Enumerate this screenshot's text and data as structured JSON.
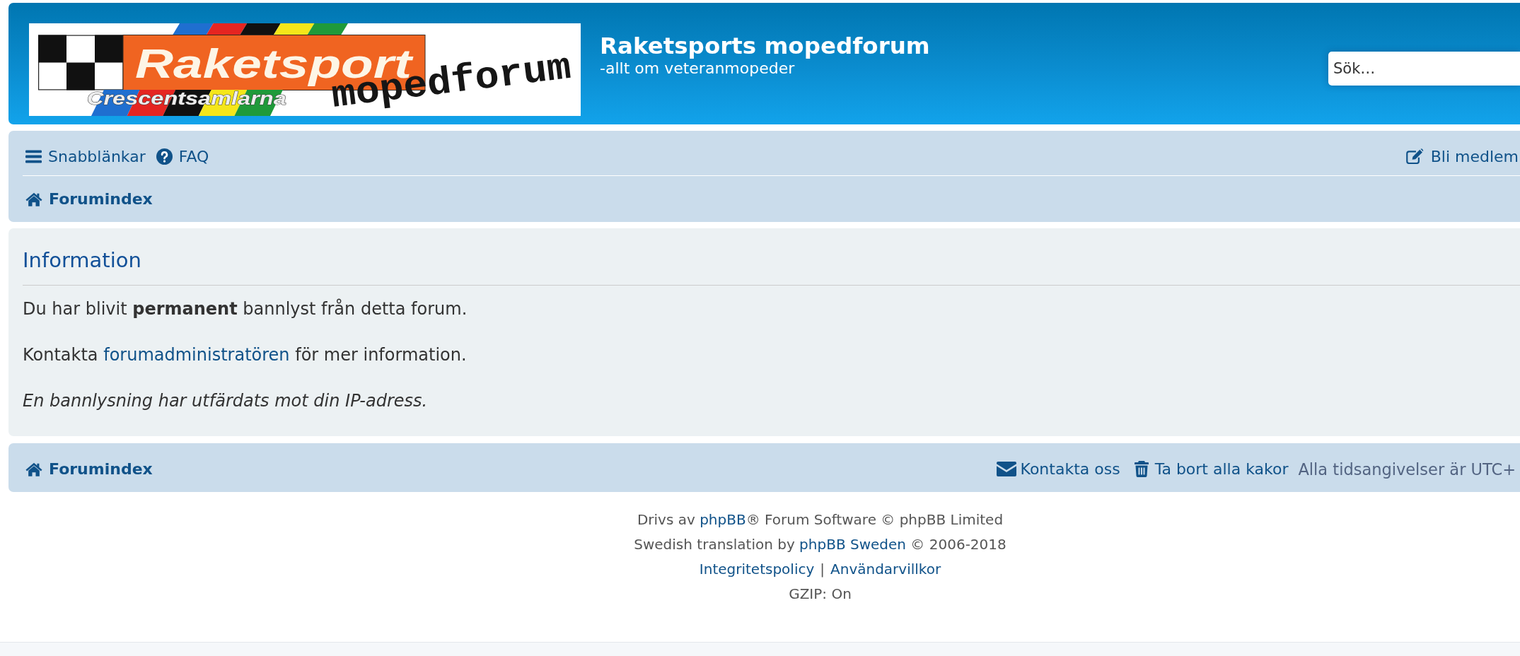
{
  "header": {
    "logo": {
      "wordmark": "Raketsport",
      "name": "mopedforum",
      "tagline": "Crescentsamlarna"
    },
    "title": "Raketsports mopedforum",
    "description": "-allt om veteranmopeder",
    "search": {
      "placeholder": "Sök…"
    }
  },
  "navbar": {
    "quick_links": "Snabblänkar",
    "faq": "FAQ",
    "register": "Bli medlem",
    "breadcrumb": "Forumindex"
  },
  "panel": {
    "title": "Information",
    "messages": [
      {
        "kind": "plain",
        "parts": [
          {
            "text": "Du har blivit **permanent** bannlyst från detta forum."
          }
        ]
      },
      {
        "kind": "plain",
        "parts": [
          {
            "text": "Kontakta "
          },
          {
            "link": "forumadministratören"
          },
          {
            "text": " för mer information."
          }
        ]
      },
      {
        "kind": "note",
        "parts": [
          {
            "text": "En bannlysning har utfärdats mot din IP-adress."
          }
        ]
      }
    ]
  },
  "footer_navbar": {
    "breadcrumb": "Forumindex",
    "contact": "Kontakta oss",
    "delete_cookies": "Ta bort alla kakor",
    "timezone": "Alla tidsangivelser är UTC+"
  },
  "copyright": [
    {
      "kind": "sentence",
      "parts": [
        {
          "text": "Drivs av "
        },
        {
          "link": "phpBB"
        },
        {
          "text": "® Forum Software © phpBB Limited"
        }
      ]
    },
    {
      "kind": "sentence",
      "parts": [
        {
          "text": "Swedish translation by "
        },
        {
          "link": "phpBB Sweden"
        },
        {
          "text": " © 2006-2018"
        }
      ]
    },
    {
      "kind": "links",
      "links": [
        "Integritetspolicy",
        "Användarvillkor"
      ],
      "separator": "|"
    },
    {
      "kind": "sentence",
      "parts": [
        {
          "text": "GZIP: On"
        }
      ]
    }
  ]
}
